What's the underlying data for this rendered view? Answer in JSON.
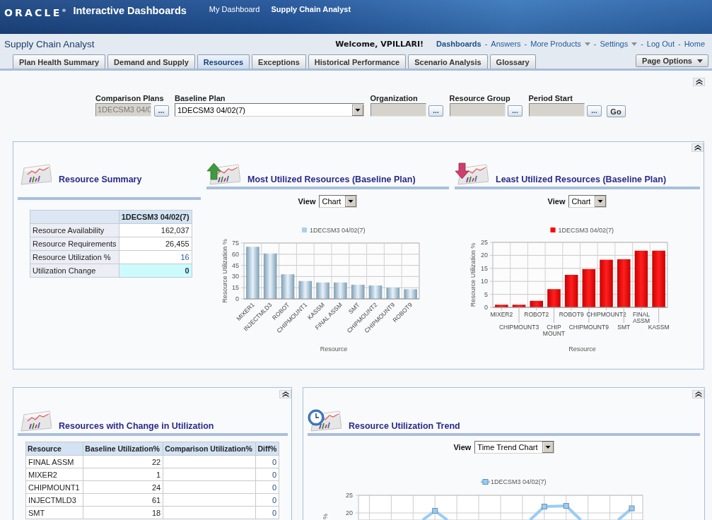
{
  "header": {
    "logo": "ORACLE$^{®}$",
    "title": "Interactive Dashboards",
    "nav": [
      {
        "label": "My Dashboard",
        "selected": false
      },
      {
        "label": "Supply Chain Analyst",
        "selected": true
      }
    ]
  },
  "dashboard_bar": {
    "title": "Supply Chain Analyst",
    "welcome": "Welcome, VPILLARI!",
    "separator": "-",
    "links": [
      {
        "label": "Dashboards",
        "selected": true,
        "menu": false
      },
      {
        "label": "Answers",
        "selected": false,
        "menu": false
      },
      {
        "label": "More Products",
        "selected": false,
        "menu": true
      },
      {
        "label": "Settings",
        "selected": false,
        "menu": true
      },
      {
        "label": "Log Out",
        "selected": false,
        "menu": false
      },
      {
        "label": "Home",
        "selected": false,
        "menu": false
      }
    ]
  },
  "tabs": [
    {
      "label": "Plan Health Summary",
      "selected": false
    },
    {
      "label": "Demand and Supply",
      "selected": false
    },
    {
      "label": "Resources",
      "selected": true
    },
    {
      "label": "Exceptions",
      "selected": false
    },
    {
      "label": "Historical Performance",
      "selected": false
    },
    {
      "label": "Scenario Analysis",
      "selected": false
    },
    {
      "label": "Glossary",
      "selected": false
    }
  ],
  "page_options": "Page Options",
  "filters": {
    "fields": [
      {
        "label": "Comparison Plans",
        "kind": "picker",
        "value": "1DECSM3 04/0",
        "button": "...",
        "disabled": true
      },
      {
        "label": "Baseline Plan",
        "kind": "select",
        "value": "1DECSM3 04/02(7)"
      },
      {
        "label": "Organization",
        "kind": "picker",
        "button": "...",
        "disabled": true
      },
      {
        "label": "Resource Group",
        "kind": "picker",
        "button": "...",
        "disabled": true
      },
      {
        "label": "Period Start",
        "kind": "picker",
        "button": "...",
        "disabled": true
      }
    ],
    "go": "Go"
  },
  "summary_panel": {
    "summary": {
      "title": "Resource Summary",
      "column": "1DECSM3 04/02(7)",
      "rows": [
        {
          "label": "Resource Availability",
          "value": "162,037",
          "kind": "plain"
        },
        {
          "label": "Resource Requirements",
          "value": "26,455",
          "kind": "plain"
        },
        {
          "label": "Resource Utilization %",
          "value": "16",
          "kind": "link"
        },
        {
          "label": "Utilization Change",
          "value": "0",
          "kind": "highlight"
        }
      ]
    },
    "charts": [
      {
        "kind": "most",
        "title": "Most Utilized Resources (Baseline Plan)",
        "view": {
          "label": "View",
          "value": "Chart"
        },
        "chart_data": {
          "type": "bar",
          "xlabel": "Resource",
          "ylabel": "Resource Utilization %",
          "categories": [
            "MIXER1",
            "INJECTMLD3",
            "ROBOT",
            "CHIPMOUNT1",
            "KASSM",
            "FINAL ASSM",
            "SMT",
            "CHIPMOUNT2",
            "CHIPMOUNT9",
            "ROBOT9"
          ],
          "series": [
            {
              "name": "1DECSM3 04/02(7)",
              "color": "#a6d2f0",
              "values": [
                70,
                61,
                33,
                24,
                22,
                22,
                19,
                18,
                15,
                13
              ]
            }
          ],
          "ylim": [
            0,
            75
          ],
          "yticks": [
            0,
            15,
            30,
            45,
            60,
            75
          ],
          "grid": true
        }
      },
      {
        "kind": "least",
        "title": "Least Utilized Resources (Baseline Plan)",
        "view": {
          "label": "View",
          "value": "Chart"
        },
        "chart_data": {
          "type": "bar",
          "xlabel": "Resource",
          "ylabel": "Resource Utilization %",
          "categories": [
            "MIXER2",
            "CHIPMOUNT3",
            "ROBOT2",
            "CHIP MOUNT",
            "ROBOT9",
            "CHIPMOUNT9",
            "CHIPMOUNT2",
            "SMT",
            "FINAL ASSM",
            "KASSM"
          ],
          "series": [
            {
              "name": "1DECSM3 04/02(7)",
              "color": "#ff0000",
              "values": [
                1,
                1,
                2.5,
                7,
                12.5,
                14.7,
                18.3,
                18.5,
                21.8,
                21.8
              ]
            }
          ],
          "ylim": [
            0,
            25
          ],
          "yticks": [
            0,
            5,
            10,
            15,
            20,
            25
          ],
          "grid": true
        }
      }
    ]
  },
  "change_panel": {
    "title": "Resources with Change in Utilization",
    "columns": [
      "Resource",
      "Baseline Utilization%",
      "Comparison Utilization%",
      "Diff%"
    ],
    "rows": [
      {
        "resource": "FINAL ASSM",
        "baseline": "22",
        "diff": "0"
      },
      {
        "resource": "MIXER2",
        "baseline": "1",
        "diff": "0"
      },
      {
        "resource": "CHIPMOUNT1",
        "baseline": "24",
        "diff": "0"
      },
      {
        "resource": "INJECTMLD3",
        "baseline": "61",
        "diff": "0"
      },
      {
        "resource": "SMT",
        "baseline": "18",
        "diff": "0"
      }
    ]
  },
  "trend_panel": {
    "title": "Resource Utilization Trend",
    "view": {
      "label": "View",
      "value": "Time Trend Chart"
    },
    "chart_data": {
      "type": "line",
      "ylabel": "%",
      "ylim": [
        18,
        25
      ],
      "yticks": [
        20,
        25
      ],
      "grid": true,
      "series": [
        {
          "name": "1DECSM3 04/02(7)",
          "color": "#99ccf5",
          "marker": "square",
          "values": [
            null,
            null,
            null,
            20.6,
            null,
            null,
            null,
            null,
            21.8,
            22,
            null,
            null,
            21.3
          ]
        }
      ]
    }
  }
}
